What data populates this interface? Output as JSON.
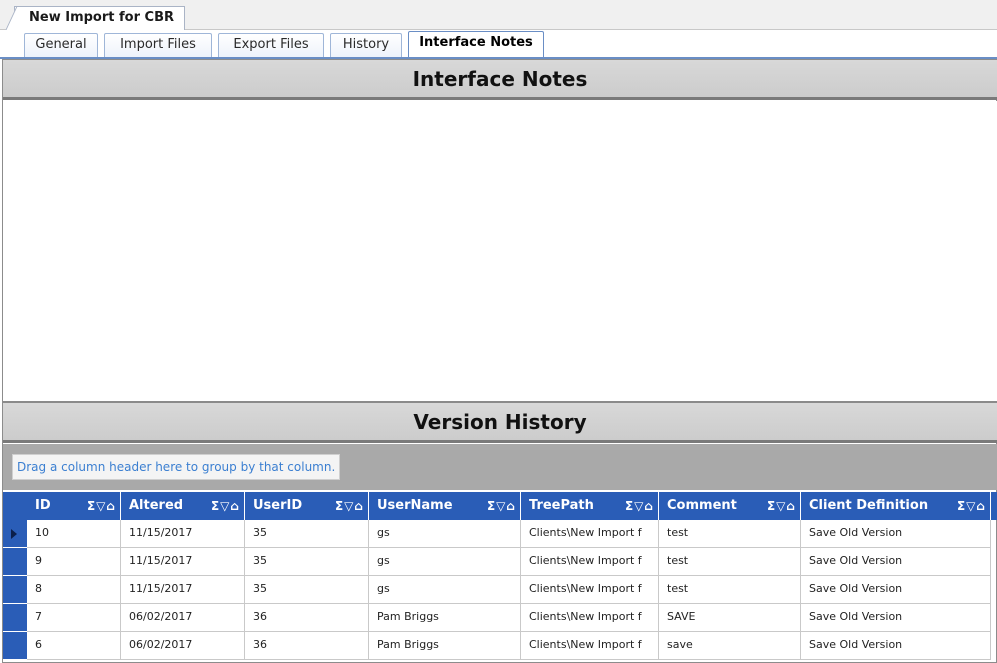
{
  "document_tab": "New Import for CBR",
  "tabs": [
    {
      "label": "General"
    },
    {
      "label": "Import Files"
    },
    {
      "label": "Export Files"
    },
    {
      "label": "History"
    },
    {
      "label": "Interface Notes"
    }
  ],
  "interface_notes": {
    "title": "Interface Notes",
    "text": ""
  },
  "version_history": {
    "title": "Version History",
    "group_hint": "Drag a column header here to group by that column.",
    "columns": [
      "ID",
      "Altered",
      "UserID",
      "UserName",
      "TreePath",
      "Comment",
      "Client Definition"
    ],
    "header_icons": "Σ▽⌂",
    "rows": [
      [
        "10",
        "11/15/2017",
        "35",
        "gs",
        "Clients\\New Import f",
        "test",
        "Save Old Version"
      ],
      [
        "9",
        "11/15/2017",
        "35",
        "gs",
        "Clients\\New Import f",
        "test",
        "Save Old Version"
      ],
      [
        "8",
        "11/15/2017",
        "35",
        "gs",
        "Clients\\New Import f",
        "test",
        "Save Old Version"
      ],
      [
        "7",
        "06/02/2017",
        "36",
        "Pam Briggs",
        "Clients\\New Import f",
        "SAVE",
        "Save Old Version"
      ],
      [
        "6",
        "06/02/2017",
        "36",
        "Pam Briggs",
        "Clients\\New Import f",
        "save",
        "Save Old Version"
      ]
    ]
  },
  "colors": {
    "grid_header": "#2a5db7",
    "group_hint_text": "#3b7fd1"
  }
}
